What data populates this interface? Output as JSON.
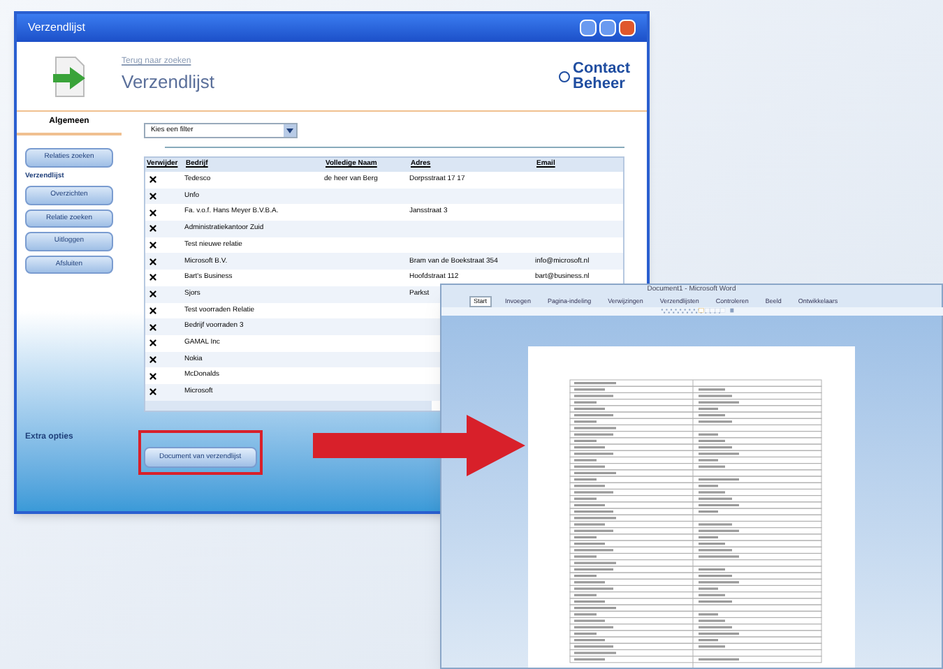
{
  "main_window": {
    "title": "Verzendlijst",
    "breadcrumb": "Terug naar zoeken",
    "heading": "Verzendlijst",
    "logo_lines": [
      "Contact",
      "Beheer"
    ],
    "sidebar": {
      "tab": {
        "label": "Algemeen",
        "selected": true
      },
      "buttons": [
        "Relaties zoeken"
      ],
      "section_label": "Verzendlijst",
      "section_buttons": [
        "Overzichten",
        "Relatie zoeken",
        "Uitloggen",
        "Afsluiten"
      ],
      "footer_label": "Extra opties"
    },
    "filter": {
      "value": "Kies een filter"
    },
    "table": {
      "columns": [
        "Verwijder",
        "Bedrijf",
        "Volledige Naam",
        "Adres",
        "Email"
      ],
      "rows": [
        {
          "company": "Tedesco",
          "name": "de heer van Berg",
          "address": "Dorpsstraat 17 17"
        },
        {
          "company": "Unfo"
        },
        {
          "company": "Fa. v.o.f. Hans Meyer B.V.B.A.",
          "address": "Jansstraat 3"
        },
        {
          "company": "Administratiekantoor Zuid"
        },
        {
          "company": "Test nieuwe relatie"
        },
        {
          "company": "Microsoft B.V.",
          "address": "Bram van de Boekstraat 354",
          "email": "info@microsoft.nl"
        },
        {
          "company": "Bart's Business",
          "address": "Hoofdstraat 112",
          "email": "bart@business.nl"
        },
        {
          "company": "Sjors",
          "address": "Parkst"
        },
        {
          "company": "Test voorraden Relatie"
        },
        {
          "company": "Bedrijf voorraden 3"
        },
        {
          "company": "GAMAL Inc"
        },
        {
          "company": "Nokia"
        },
        {
          "company": "McDonalds"
        },
        {
          "company": "Microsoft"
        }
      ]
    },
    "action_button": "Document van verzendlijst"
  },
  "word_window": {
    "title": "Document1 - Microsoft Word",
    "tabs": [
      {
        "label": "Start",
        "selected": true
      },
      {
        "label": "Invoegen",
        "selected": false
      },
      {
        "label": "Pagina-indeling",
        "selected": false
      },
      {
        "label": "Verwijzingen",
        "selected": false
      },
      {
        "label": "Verzendlijsten",
        "selected": false
      },
      {
        "label": "Controleren",
        "selected": false
      },
      {
        "label": "Beeld",
        "selected": false
      },
      {
        "label": "Ontwikkelaars",
        "selected": false
      }
    ]
  }
}
